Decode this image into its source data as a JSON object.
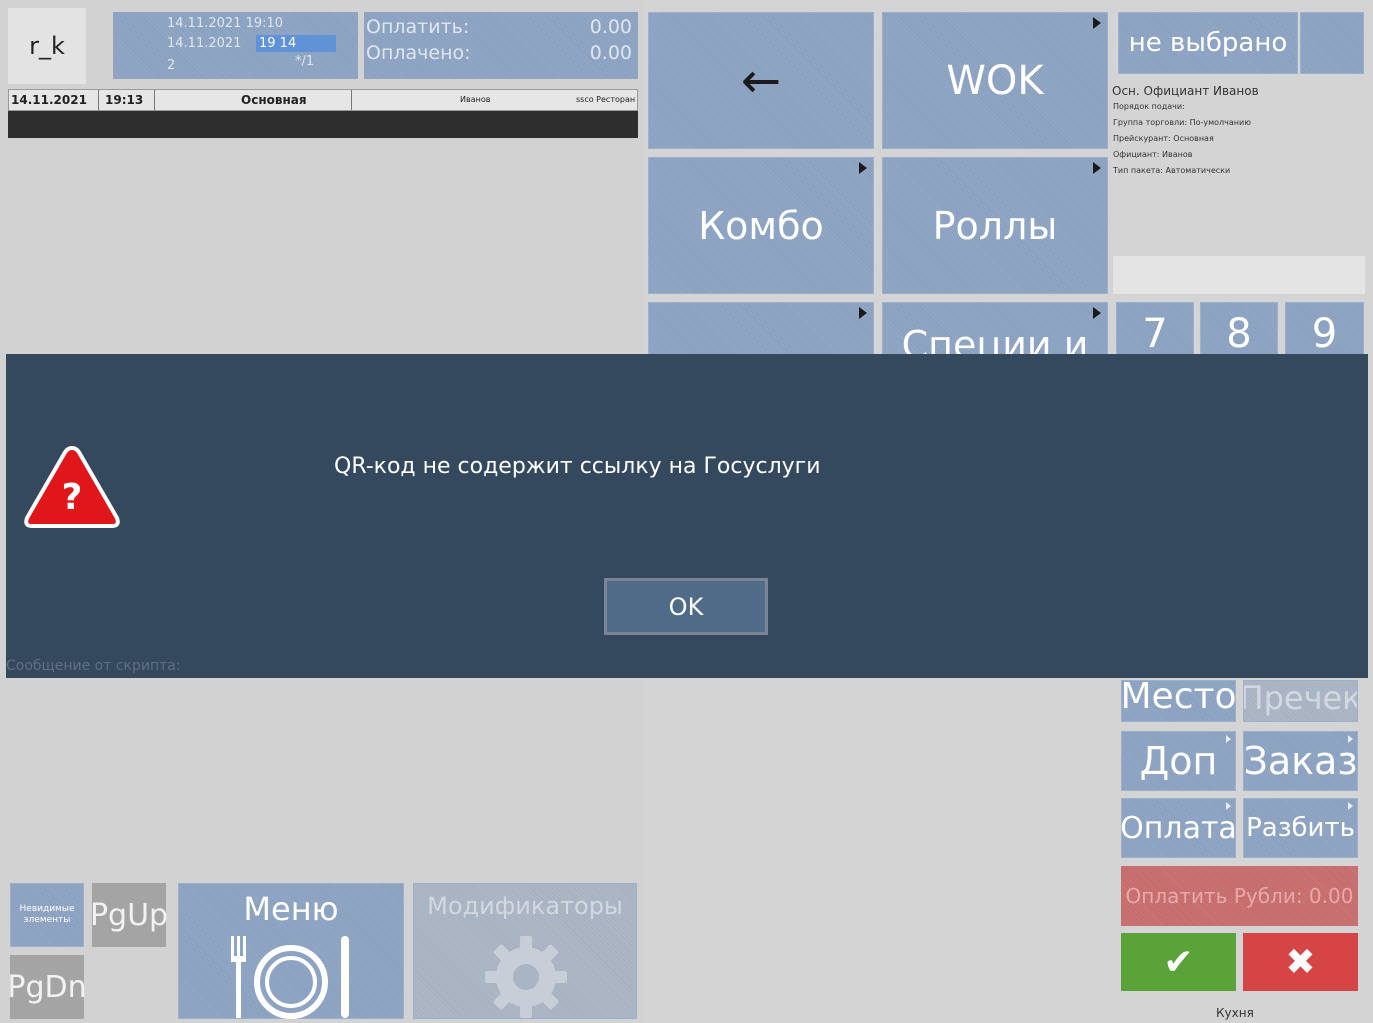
{
  "logo": "r_k",
  "order_info": {
    "opened": "14.11.2021 19:10",
    "current_date": "14.11.2021",
    "current_time_highlight": "19 14",
    "guests": "2",
    "table_suffix": "*/1"
  },
  "payment": {
    "to_pay_label": "Оплатить:",
    "to_pay_value": "0.00",
    "paid_label": "Оплачено:",
    "paid_value": "0.00"
  },
  "status_bar": {
    "date": "14.11.2021",
    "time": "19:13",
    "menu": "Основная",
    "waiter": "Иванов",
    "station": "ssco Ресторан"
  },
  "menu_tiles": {
    "back": "←",
    "wok": "WOK",
    "combo": "Комбо",
    "rolls": "Роллы",
    "spices": "Специи и"
  },
  "waiter_panel": {
    "select_label": "не выбрано",
    "main_waiter": "Осн. Официант  Иванов",
    "info_lines": [
      "Порядок подачи:",
      "Группа торговли: По-умолчанию",
      "Прейскурант: Основная",
      "Официант: Иванов",
      "Тип пакета: Автоматически"
    ]
  },
  "numpad": [
    "7",
    "8",
    "9"
  ],
  "dialog": {
    "message": "QR-код не содержит ссылку на Госуслуги",
    "ok_label": "OK",
    "footer": "Сообщение от скрипта:",
    "icon_glyph": "?"
  },
  "actions": {
    "place": "Место",
    "precheck": "Пречек",
    "extra": "Доп",
    "order": "Заказ",
    "payment": "Оплата",
    "split": "Разбить",
    "pay_rub": "Оплатить Рубли: 0.00",
    "confirm_glyph": "✔",
    "cancel_glyph": "✖",
    "kitchen": "Кухня"
  },
  "bottom": {
    "invisible_items": "Невидимые элементы",
    "pgup": "PgUp",
    "pgdn": "PgDn",
    "menu": "Меню",
    "modifiers": "Модификаторы"
  },
  "colors": {
    "tile": "#8aa2c3",
    "dialog_bg": "#34485e",
    "ok_bg": "#4f6b88",
    "warning_red": "#e0161b",
    "confirm_green": "#5aa339",
    "cancel_red": "#d64545",
    "pay_red": "#c86a6a"
  }
}
